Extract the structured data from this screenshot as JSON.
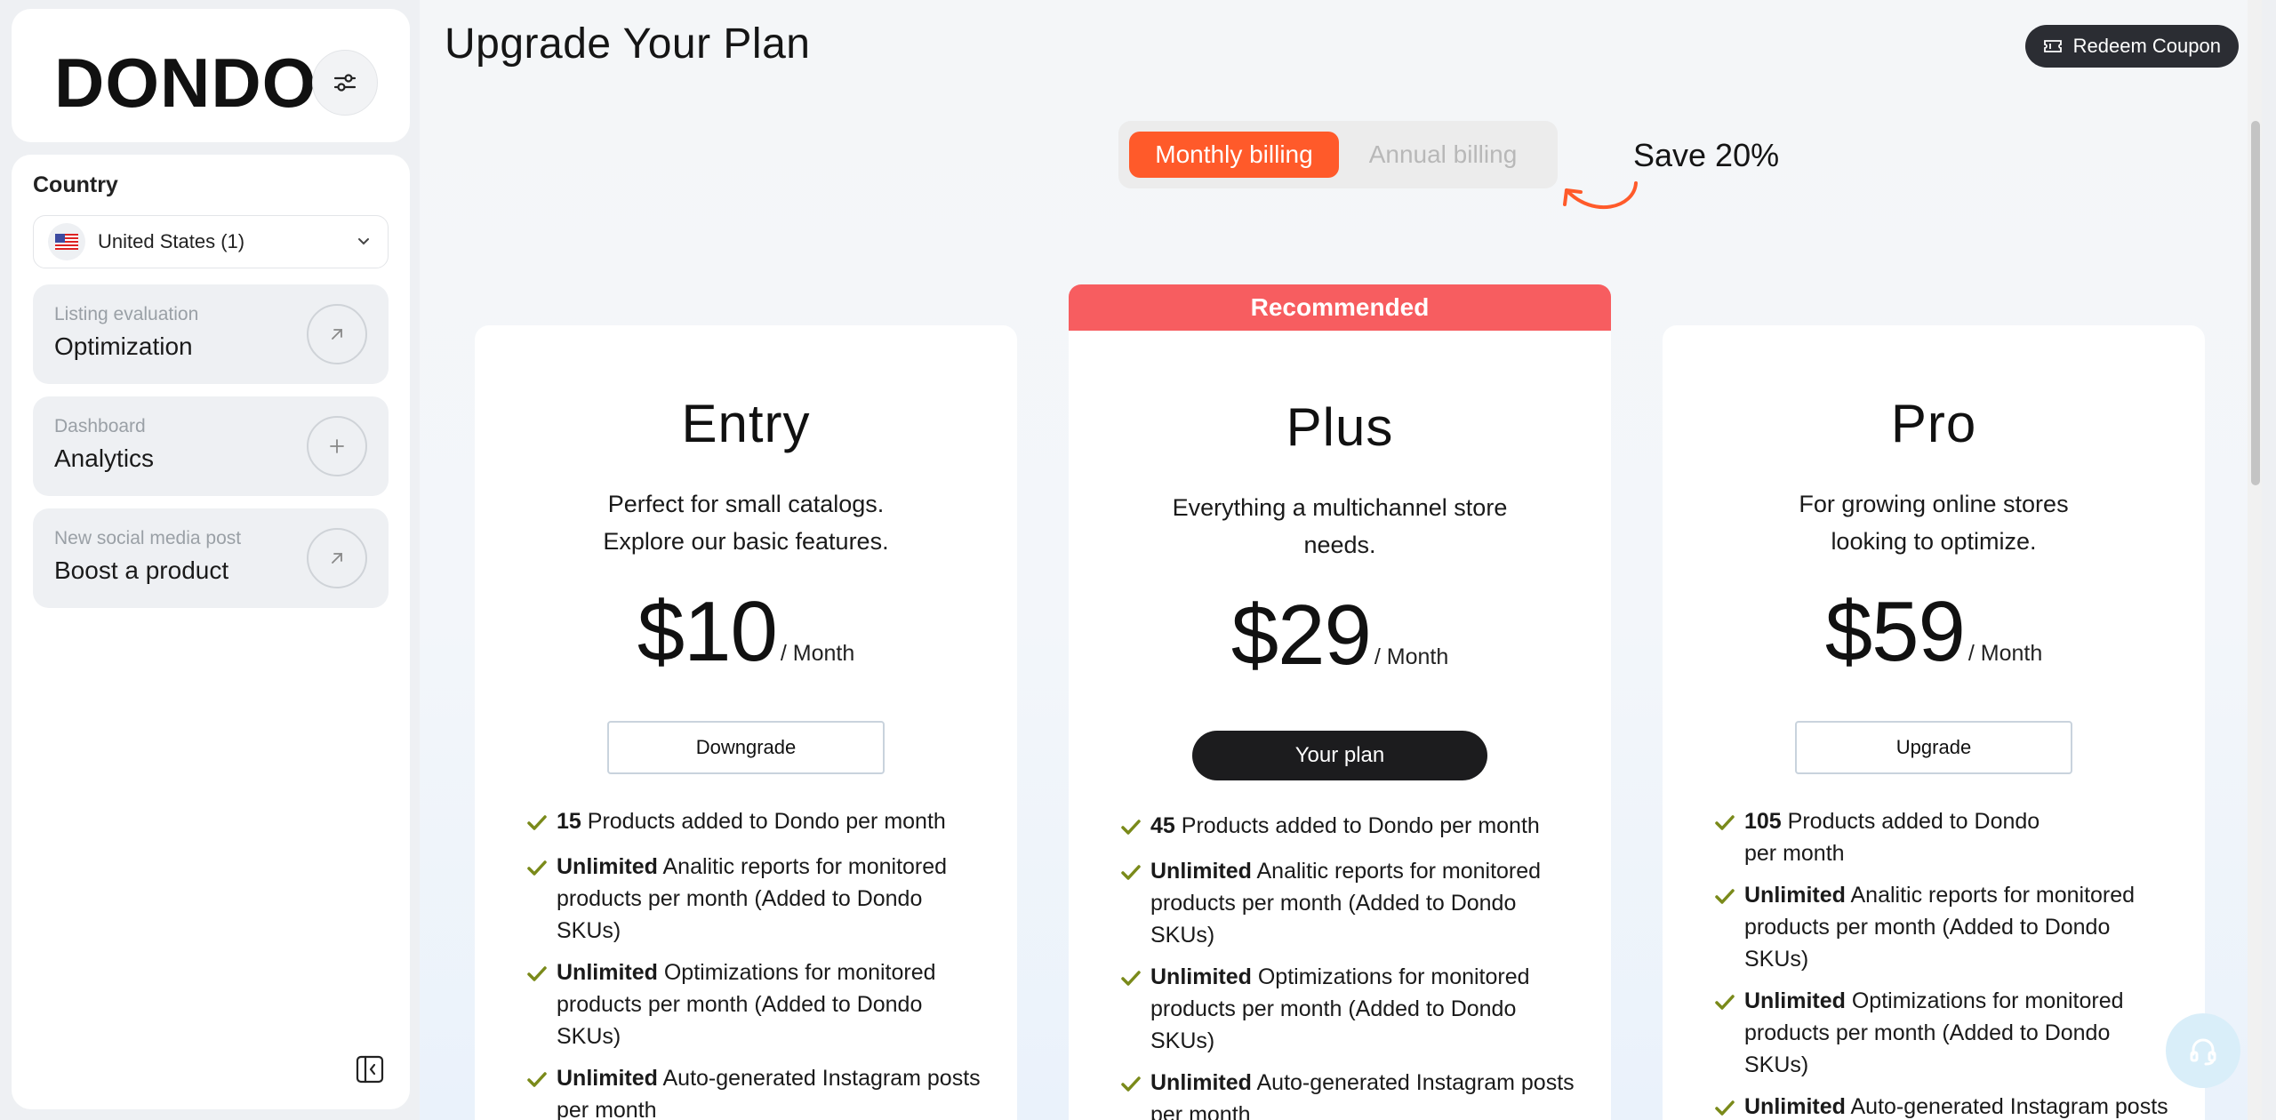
{
  "sidebar": {
    "logo": "DONDO",
    "country_label": "Country",
    "country_value": "United States (1)",
    "actions": [
      {
        "sub": "Listing evaluation",
        "title": "Optimization",
        "icon": "arrow-up-right-icon"
      },
      {
        "sub": "Dashboard",
        "title": "Analytics",
        "icon": "plus-icon"
      },
      {
        "sub": "New social media post",
        "title": "Boost a product",
        "icon": "arrow-up-right-icon"
      }
    ]
  },
  "header": {
    "title": "Upgrade Your Plan",
    "redeem_label": "Redeem Coupon"
  },
  "billing": {
    "monthly": "Monthly billing",
    "annual": "Annual billing",
    "active": "monthly",
    "save_note": "Save 20%"
  },
  "plans": [
    {
      "name": "Entry",
      "desc1": "Perfect for small catalogs.",
      "desc2": "Explore our basic features.",
      "price": "$10",
      "unit": "/ Month",
      "button": "Downgrade",
      "features": [
        {
          "bold": "15",
          "text": "Products added to Dondo per month"
        },
        {
          "bold": "Unlimited",
          "text": "Analitic reports for monitored products per month (Added to Dondo SKUs)"
        },
        {
          "bold": "Unlimited",
          "text": "Optimizations for monitored products per month (Added to Dondo SKUs)"
        },
        {
          "bold": "Unlimited",
          "text": "Auto-generated Instagram posts per month"
        }
      ]
    },
    {
      "name": "Plus",
      "badge": "Recommended",
      "desc1": "Everything a multichannel store",
      "desc2": "needs.",
      "price": "$29",
      "unit": "/ Month",
      "button": "Your plan",
      "features": [
        {
          "bold": "45",
          "text": "Products added to Dondo per month"
        },
        {
          "bold": "Unlimited",
          "text": "Analitic reports for monitored products per month (Added to Dondo SKUs)"
        },
        {
          "bold": "Unlimited",
          "text": "Optimizations for monitored products per month (Added to Dondo SKUs)"
        },
        {
          "bold": "Unlimited",
          "text": "Auto-generated Instagram posts per month"
        }
      ]
    },
    {
      "name": "Pro",
      "desc1": "For growing online stores",
      "desc2": "looking to optimize.",
      "price": "$59",
      "unit": "/ Month",
      "button": "Upgrade",
      "features": [
        {
          "bold": "105",
          "text": "Products added to Dondo per month"
        },
        {
          "bold": "Unlimited",
          "text": "Analitic reports for monitored products per month (Added to Dondo SKUs)"
        },
        {
          "bold": "Unlimited",
          "text": "Optimizations for monitored products per month (Added to Dondo SKUs)"
        },
        {
          "bold": "Unlimited",
          "text": "Auto-generated Instagram posts per month"
        }
      ]
    }
  ],
  "colors": {
    "accent": "#ff5a2a",
    "recommended": "#f75d60",
    "check": "#7a8a1a",
    "dark": "#1c1c1e"
  }
}
